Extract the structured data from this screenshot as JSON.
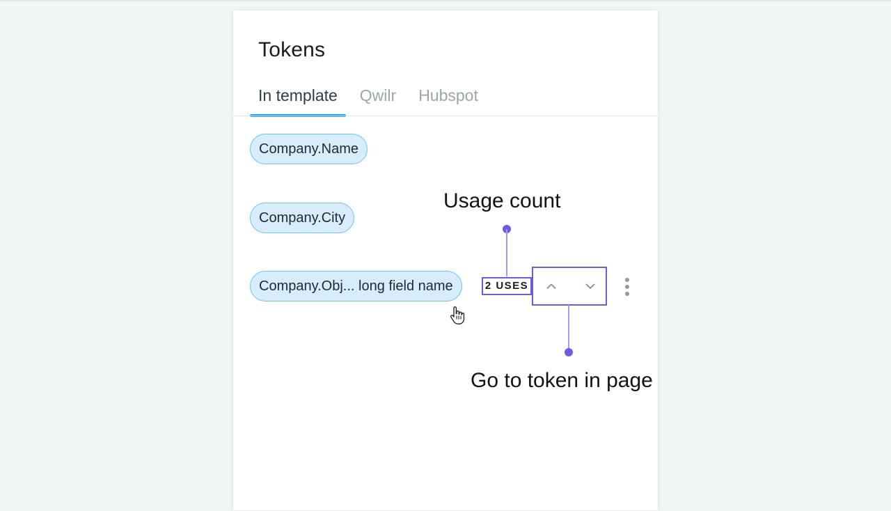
{
  "panel": {
    "title": "Tokens"
  },
  "tabs": [
    {
      "label": "In template",
      "active": true
    },
    {
      "label": "Qwilr",
      "active": false
    },
    {
      "label": "Hubspot",
      "active": false
    }
  ],
  "tokens": [
    {
      "label": "Company.Name"
    },
    {
      "label": "Company.City"
    },
    {
      "label": "Company.Obj... long field name"
    }
  ],
  "token_controls": {
    "uses_label": "2 USES",
    "prev_icon": "chevron-up-icon",
    "next_icon": "chevron-down-icon",
    "more_icon": "vertical-ellipsis-icon"
  },
  "annotations": {
    "usage_count": "Usage count",
    "go_to_token": "Go to token in page"
  },
  "colors": {
    "background": "#f1f5f6",
    "token_fill": "#d7edfb",
    "token_border": "#6dc2ef",
    "tab_active_underline": "#1f9fff",
    "annotation_accent": "#6b5ce7",
    "annotation_line": "#a69cf2",
    "icon_gray": "#8a9aa2"
  }
}
